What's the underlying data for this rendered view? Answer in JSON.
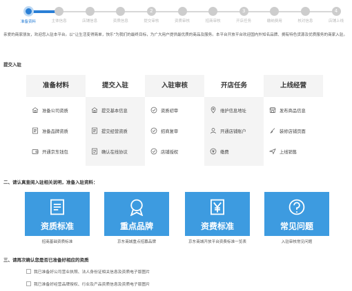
{
  "progress": {
    "steps": [
      {
        "label": "准备资料",
        "num": "",
        "active": true
      },
      {
        "label": "主体信息",
        "num": "",
        "active": false
      },
      {
        "label": "店铺信息",
        "num": "",
        "active": false
      },
      {
        "label": "资质信息",
        "num": "",
        "active": false
      },
      {
        "label": "提交审核",
        "num": "2",
        "active": false
      },
      {
        "label": "资质审核",
        "num": "",
        "active": false
      },
      {
        "label": "招商审核",
        "num": "",
        "active": false
      },
      {
        "label": "开店任务",
        "num": "3",
        "active": false
      },
      {
        "label": "缴纳费用",
        "num": "",
        "active": false
      },
      {
        "label": "核对信息",
        "num": "",
        "active": false
      },
      {
        "label": "店铺上线",
        "num": "4",
        "active": false
      }
    ]
  },
  "intro": "亲爱的商家朋友，欢迎您入驻本平台。以“让生活变得简单，快乐”为我们的最终目标，为广大用户提供最优质的商品及服务。本平台开放平台欢迎国内外知名品牌、拥有特色货源及优质服务的商家入驻。",
  "section1": {
    "title": "提交入驻"
  },
  "process": {
    "columns": [
      {
        "title": "准备材料",
        "items": [
          {
            "icon": "home-icon",
            "label": "准备公司资质"
          },
          {
            "icon": "document-icon",
            "label": "准备品牌资质"
          },
          {
            "icon": "wallet-icon",
            "label": "开通京东钱包"
          }
        ]
      },
      {
        "title": "提交入驻",
        "items": [
          {
            "icon": "home-icon",
            "label": "提交基本信息"
          },
          {
            "icon": "document-icon",
            "label": "提交经营资质"
          },
          {
            "icon": "contract-icon",
            "label": "确认在线协议"
          }
        ]
      },
      {
        "title": "入驻审核",
        "items": [
          {
            "icon": "check-icon",
            "label": "资质初审"
          },
          {
            "icon": "check-icon",
            "label": "招商复审"
          },
          {
            "icon": "check-icon",
            "label": "店铺授权"
          }
        ]
      },
      {
        "title": "开店任务",
        "items": [
          {
            "icon": "location-icon",
            "label": "维护信息地址"
          },
          {
            "icon": "user-icon",
            "label": "开通店铺账户"
          },
          {
            "icon": "coin-icon",
            "label": "缴费"
          }
        ]
      },
      {
        "title": "上线经营",
        "items": [
          {
            "icon": "shop-icon",
            "label": "发布商品信息"
          },
          {
            "icon": "brush-icon",
            "label": "装修店铺页面"
          },
          {
            "icon": "send-icon",
            "label": "上线销售"
          }
        ]
      }
    ]
  },
  "section2": {
    "title": "二、请认真查阅入驻相关说明，准备入驻资料："
  },
  "cards": [
    {
      "title": "资质标准",
      "caption": "招商基础资质标准",
      "icon": "document-icon"
    },
    {
      "title": "重点品牌",
      "caption": "京东商城重点招募品牌",
      "icon": "badge-icon"
    },
    {
      "title": "资费标准",
      "caption": "京东商城开放平台资费标准一览表",
      "icon": "yen-icon"
    },
    {
      "title": "常见问题",
      "caption": "入驻审核常见问题",
      "icon": "question-icon"
    }
  ],
  "section3": {
    "title": "三、请再次确认您是否已准备好相应的资质"
  },
  "checks": [
    "我已准备好公司营业执照、法人身份证相关信息及资质电子版图片",
    "我已准备好经营品牌授权、行业及产品资质信息及资质电子版图片"
  ],
  "colors": {
    "accent": "#2a7fd6",
    "card": "#3d9be0"
  }
}
